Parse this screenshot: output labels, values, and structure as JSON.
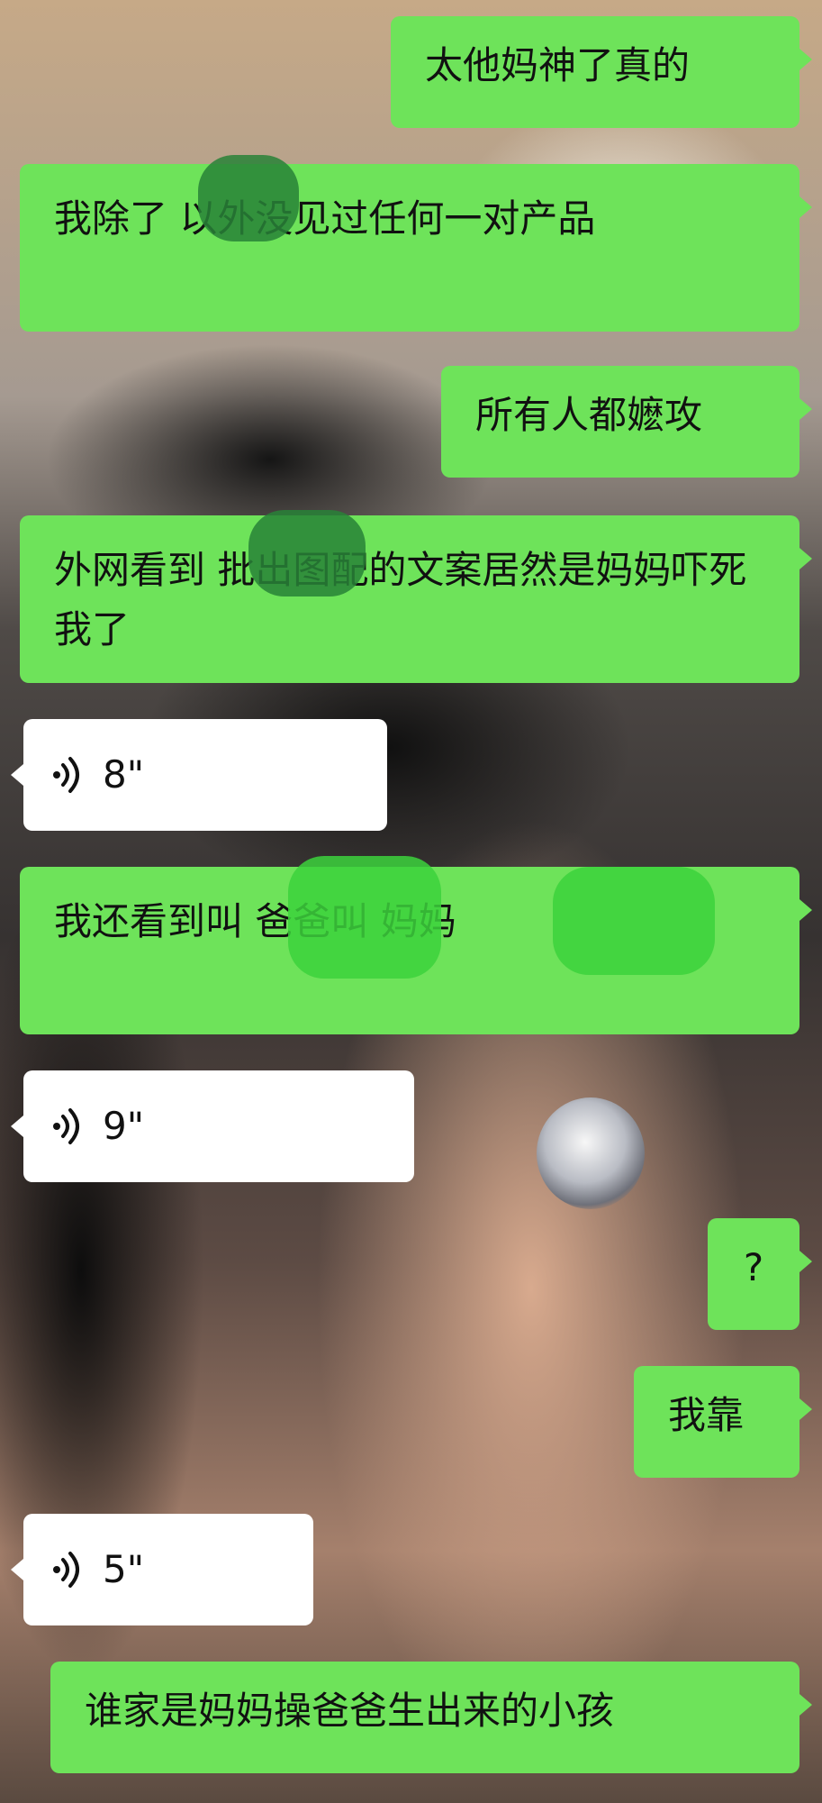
{
  "chat": {
    "messages": [
      {
        "sender": "self",
        "text": "太他妈神了真的"
      },
      {
        "sender": "self",
        "text": "我除了            以外没见过任何一对产品"
      },
      {
        "sender": "self",
        "text": "所有人都嬷攻"
      },
      {
        "sender": "self",
        "text": "外网看到          批出图配的文案居然是妈妈吓死我了"
      },
      {
        "sender": "other",
        "type": "voice",
        "duration": "8\""
      },
      {
        "sender": "self",
        "text": "我还看到叫                爸爸叫              妈妈"
      },
      {
        "sender": "other",
        "type": "voice",
        "duration": "9\""
      },
      {
        "sender": "self",
        "text": "?"
      },
      {
        "sender": "self",
        "text": "我靠"
      },
      {
        "sender": "other",
        "type": "voice",
        "duration": "5\""
      },
      {
        "sender": "self",
        "text": "谁家是妈妈操爸爸生出来的小孩"
      }
    ]
  },
  "icons": {
    "voice": "voice-wave-icon"
  },
  "colors": {
    "self_bubble": "#6ee35a",
    "other_bubble": "#ffffff",
    "text": "#111111",
    "redaction": "#3cd23c"
  }
}
